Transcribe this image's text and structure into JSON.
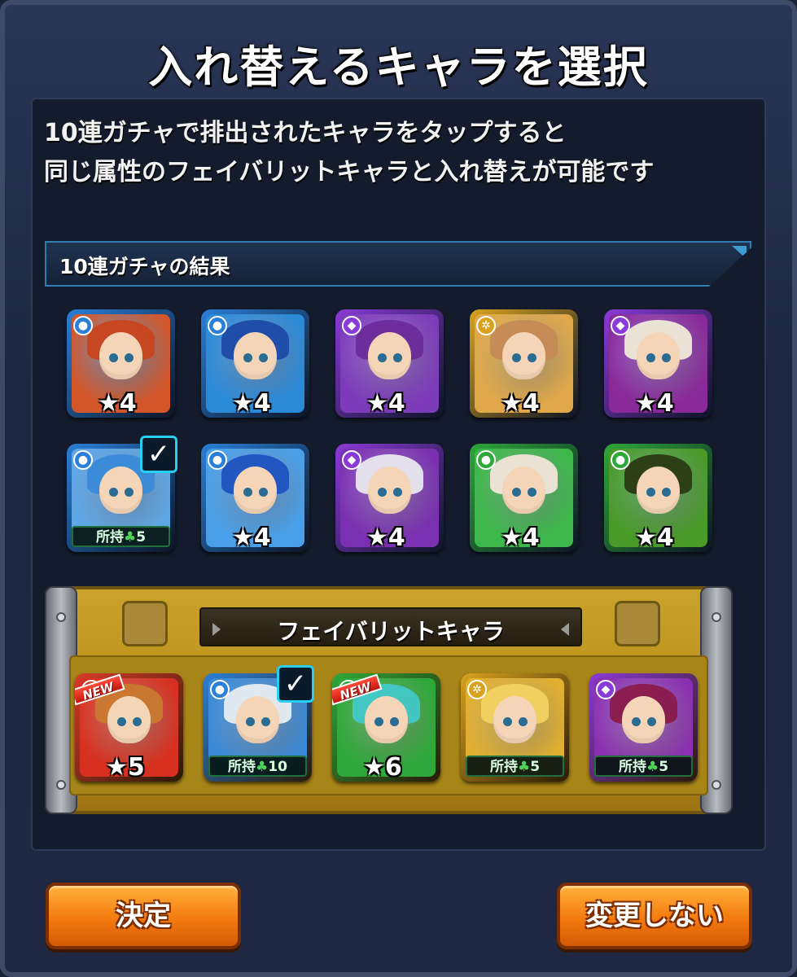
{
  "dialog": {
    "title": "入れ替えるキャラを選択",
    "description_line1": "10連ガチャで排出されたキャラをタップすると",
    "description_line2": "同じ属性のフェイバリットキャラと入れ替えが可能です"
  },
  "gacha_results": {
    "label": "10連ガチャの結果",
    "cards": [
      {
        "name": "character-1",
        "attribute": "water",
        "attr_color": "#2a7fd8",
        "stars": "★4",
        "owned": "",
        "checked": false,
        "hair": "#c8441c",
        "bg": "#d2562a"
      },
      {
        "name": "character-2",
        "attribute": "water",
        "attr_color": "#2a7fd8",
        "stars": "★4",
        "owned": "",
        "checked": false,
        "hair": "#1e4aa8",
        "bg": "#2b8ad8"
      },
      {
        "name": "character-3",
        "attribute": "dark",
        "attr_color": "#8a3ad8",
        "stars": "★4",
        "owned": "",
        "checked": false,
        "hair": "#6b2b9a",
        "bg": "#7c3cba"
      },
      {
        "name": "character-4",
        "attribute": "light",
        "attr_color": "#d8a21e",
        "stars": "★4",
        "owned": "",
        "checked": false,
        "hair": "#c48a55",
        "bg": "#e0a84a"
      },
      {
        "name": "character-5",
        "attribute": "dark",
        "attr_color": "#8a3ad8",
        "stars": "★4",
        "owned": "",
        "checked": false,
        "hair": "#f0ead8",
        "bg": "#8a2a9a"
      },
      {
        "name": "character-6",
        "attribute": "water",
        "attr_color": "#2a7fd8",
        "stars": "",
        "owned": "所持",
        "owned_count": "5",
        "checked": true,
        "hair": "#3a8ad8",
        "bg": "#5fa8e8"
      },
      {
        "name": "character-7",
        "attribute": "water",
        "attr_color": "#2a7fd8",
        "stars": "★4",
        "owned": "",
        "checked": false,
        "hair": "#1f52c0",
        "bg": "#4aa0e8"
      },
      {
        "name": "character-8",
        "attribute": "dark",
        "attr_color": "#8a3ad8",
        "stars": "★4",
        "owned": "",
        "checked": false,
        "hair": "#e8e8ee",
        "bg": "#7a30b0"
      },
      {
        "name": "character-9",
        "attribute": "wood",
        "attr_color": "#2ea83a",
        "stars": "★4",
        "owned": "",
        "checked": false,
        "hair": "#f2e6da",
        "bg": "#3cb84a"
      },
      {
        "name": "character-10",
        "attribute": "wood",
        "attr_color": "#2ea83a",
        "stars": "★4",
        "owned": "",
        "checked": false,
        "hair": "#2a3a14",
        "bg": "#4a9a2a"
      }
    ]
  },
  "favorites": {
    "label": "フェイバリットキャラ",
    "cards": [
      {
        "name": "favorite-1",
        "attribute": "fire",
        "attr_color": "#d83a2a",
        "stars": "★5",
        "owned": "",
        "new": true,
        "new_label": "NEW",
        "checked": false,
        "hair": "#c97a30",
        "bg": "#d83020"
      },
      {
        "name": "favorite-2",
        "attribute": "water",
        "attr_color": "#2a7fd8",
        "stars": "",
        "owned": "所持",
        "owned_count": "10",
        "new": false,
        "checked": true,
        "hair": "#e8eef2",
        "bg": "#3a8ad8"
      },
      {
        "name": "favorite-3",
        "attribute": "wood",
        "attr_color": "#2ea83a",
        "stars": "★6",
        "owned": "",
        "new": true,
        "new_label": "NEW",
        "checked": false,
        "hair": "#42c8c8",
        "bg": "#2ea83a"
      },
      {
        "name": "favorite-4",
        "attribute": "light",
        "attr_color": "#d8a21e",
        "stars": "",
        "owned": "所持",
        "owned_count": "5",
        "new": false,
        "checked": false,
        "hair": "#f2d262",
        "bg": "#e0b030"
      },
      {
        "name": "favorite-5",
        "attribute": "dark",
        "attr_color": "#8a3ad8",
        "stars": "",
        "owned": "所持",
        "owned_count": "5",
        "new": false,
        "checked": false,
        "hair": "#8a1a4a",
        "bg": "#8a30b0"
      }
    ]
  },
  "buttons": {
    "confirm_label": "決定",
    "no_change_label": "変更しない"
  },
  "icons": {
    "clover": "♣",
    "check": "✓",
    "attr_water": "●",
    "attr_dark": "◆",
    "attr_light": "✲",
    "attr_wood": "●",
    "attr_fire": "●"
  }
}
